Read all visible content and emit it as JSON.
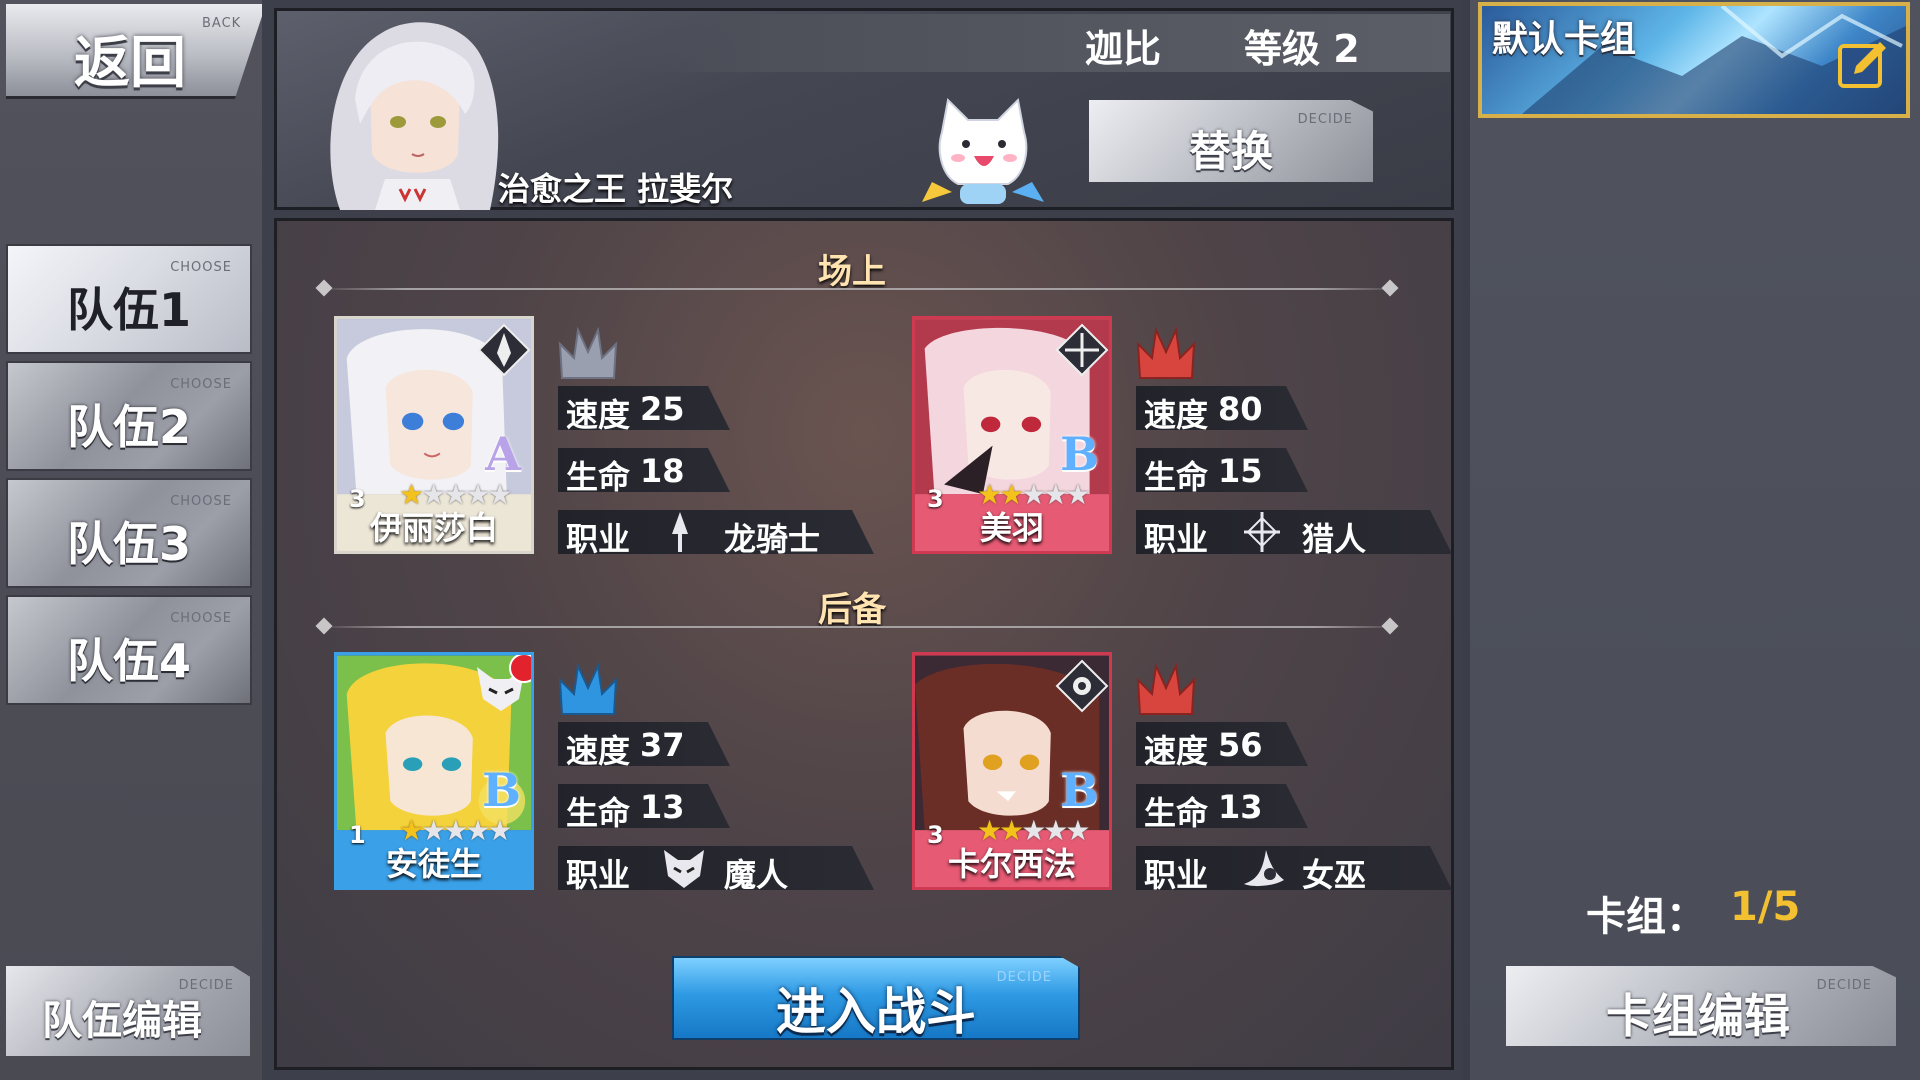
{
  "back": {
    "label": "返回",
    "tag": "BACK"
  },
  "teams": [
    {
      "label": "队伍1",
      "tag": "CHOOSE",
      "active": true
    },
    {
      "label": "队伍2",
      "tag": "CHOOSE"
    },
    {
      "label": "队伍3",
      "tag": "CHOOSE"
    },
    {
      "label": "队伍4",
      "tag": "CHOOSE"
    }
  ],
  "team_edit": {
    "label": "队伍编辑",
    "tag": "DECIDE"
  },
  "player": {
    "name": "迦比",
    "level": "等级 2"
  },
  "hero": {
    "name": "治愈之王 拉斐尔"
  },
  "replace": {
    "label": "替换",
    "tag": "DECIDE"
  },
  "sections": {
    "field": "场上",
    "reserve": "后备"
  },
  "cards": [
    {
      "name": "伊丽莎白",
      "level": "3",
      "rank": "A",
      "stars": 1,
      "stat_speed_label": "速度",
      "speed": "25",
      "stat_hp_label": "生命",
      "hp": "18",
      "stat_job_label": "职业",
      "job": "龙骑士",
      "job_icon": "lance-icon",
      "crest_color": "#9a9fb0"
    },
    {
      "name": "美羽",
      "level": "3",
      "rank": "B",
      "stars": 2,
      "stat_speed_label": "速度",
      "speed": "80",
      "stat_hp_label": "生命",
      "hp": "15",
      "stat_job_label": "职业",
      "job": "猎人",
      "job_icon": "crosshair-icon",
      "crest_color": "#d8453f"
    },
    {
      "name": "安徒生",
      "level": "1",
      "rank": "B",
      "stars": 1,
      "stat_speed_label": "速度",
      "speed": "37",
      "stat_hp_label": "生命",
      "hp": "13",
      "stat_job_label": "职业",
      "job": "魔人",
      "job_icon": "demon-mask-icon",
      "crest_color": "#2f95e0"
    },
    {
      "name": "卡尔西法",
      "level": "3",
      "rank": "B",
      "stars": 2,
      "stat_speed_label": "速度",
      "speed": "56",
      "stat_hp_label": "生命",
      "hp": "13",
      "stat_job_label": "职业",
      "job": "女巫",
      "job_icon": "witch-hat-icon",
      "crest_color": "#d8453f"
    }
  ],
  "battle": {
    "label": "进入战斗",
    "tag": "DECIDE"
  },
  "deck": {
    "banner": "默认卡组",
    "count_label": "卡组：",
    "count_value": "1/5",
    "edit_label": "卡组编辑",
    "edit_tag": "DECIDE"
  },
  "colors": {
    "accent_gold": "#f2c030",
    "battle_blue": "#2f9ae4",
    "banner_border": "#d8b04a"
  }
}
